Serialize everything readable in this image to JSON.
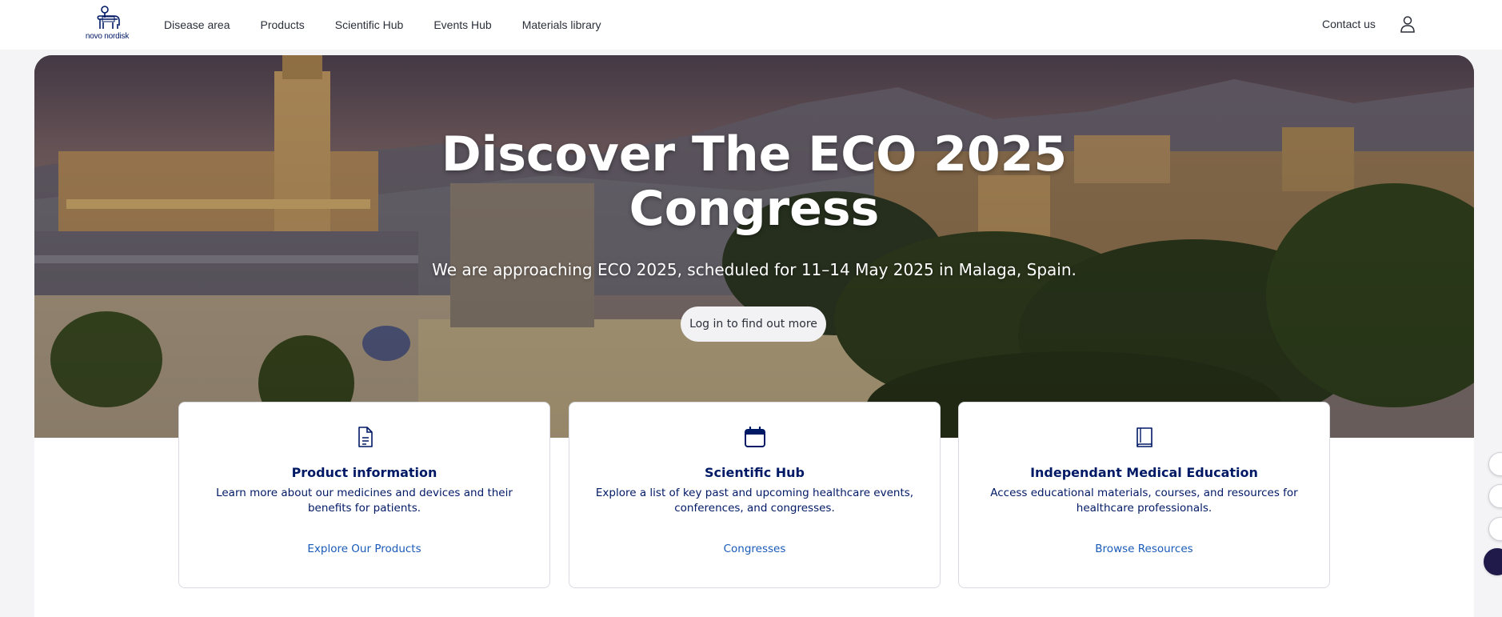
{
  "header": {
    "logo_text": "novo nordisk",
    "nav": [
      "Disease area",
      "Products",
      "Scientific Hub",
      "Events Hub",
      "Materials library"
    ],
    "contact_label": "Contact us"
  },
  "hero": {
    "title_line1": "Discover The ECO 2025",
    "title_line2": "Congress",
    "subtitle": "We are approaching ECO 2025, scheduled for 11–14 May 2025 in Malaga, Spain.",
    "button_label": "Log in to find out more"
  },
  "cards": [
    {
      "icon": "document-icon",
      "title": "Product information",
      "description": "Learn more about our medicines and devices and their benefits for patients.",
      "link": "Explore Our Products"
    },
    {
      "icon": "calendar-icon",
      "title": "Scientific Hub",
      "description": "Explore a list of key past and upcoming healthcare events, conferences, and congresses.",
      "link": "Congresses"
    },
    {
      "icon": "book-icon",
      "title": "Independant Medical Education",
      "description": "Access educational materials, courses, and resources for healthcare professionals.",
      "link": "Browse Resources"
    }
  ],
  "colors": {
    "brand_navy": "#001965",
    "link_blue": "#1a5bb8"
  }
}
